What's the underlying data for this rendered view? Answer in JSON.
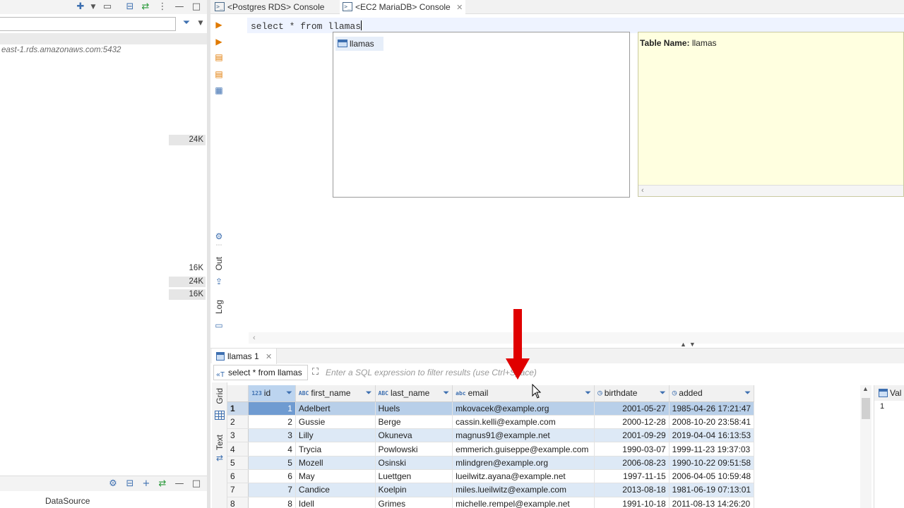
{
  "left_panel": {
    "connection_url": "east-1.rds.amazonaws.com:5432",
    "sizes": [
      "24K",
      "16K",
      "24K",
      "16K"
    ],
    "bottom_label": "DataSource"
  },
  "tabs": [
    {
      "label": "<Postgres RDS> Console",
      "active": false
    },
    {
      "label": "<EC2 MariaDB> Console",
      "active": true,
      "close": "✕"
    }
  ],
  "editor": {
    "sql": "select * from llamas",
    "side_labels": {
      "out": "Out",
      "log": "Log"
    }
  },
  "autocomplete": {
    "item": "llamas",
    "info_label": "Table Name:",
    "info_value": "llamas"
  },
  "results": {
    "tab_label": "llamas 1",
    "tab_close": "✕",
    "query_label": "select * from llamas",
    "filter_placeholder": "Enter a SQL expression to filter results (use Ctrl+Space)",
    "side_tabs": {
      "grid": "Grid",
      "text": "Text"
    },
    "columns": [
      {
        "name": "id",
        "type": "123"
      },
      {
        "name": "first_name",
        "type": "ABC"
      },
      {
        "name": "last_name",
        "type": "ABC"
      },
      {
        "name": "email",
        "type": "abc"
      },
      {
        "name": "birthdate",
        "type": "date"
      },
      {
        "name": "added",
        "type": "date"
      }
    ],
    "rows": [
      [
        "1",
        "1",
        "Adelbert",
        "Huels",
        "mkovacek@example.org",
        "2001-05-27",
        "1985-04-26 17:21:47"
      ],
      [
        "2",
        "2",
        "Gussie",
        "Berge",
        "cassin.kelli@example.com",
        "2000-12-28",
        "2008-10-20 23:58:41"
      ],
      [
        "3",
        "3",
        "Lilly",
        "Okuneva",
        "magnus91@example.net",
        "2001-09-29",
        "2019-04-04 16:13:53"
      ],
      [
        "4",
        "4",
        "Trycia",
        "Powlowski",
        "emmerich.guiseppe@example.com",
        "1990-03-07",
        "1999-11-23 19:37:03"
      ],
      [
        "5",
        "5",
        "Mozell",
        "Osinski",
        "mlindgren@example.org",
        "2006-08-23",
        "1990-10-22 09:51:58"
      ],
      [
        "6",
        "6",
        "May",
        "Luettgen",
        "lueilwitz.ayana@example.net",
        "1997-11-15",
        "2006-04-05 10:59:48"
      ],
      [
        "7",
        "7",
        "Candice",
        "Koelpin",
        "miles.lueilwitz@example.com",
        "2013-08-18",
        "1981-06-19 07:13:01"
      ],
      [
        "8",
        "8",
        "Idell",
        "Grimes",
        "michelle.rempel@example.net",
        "1991-10-18",
        "2011-08-13 14:26:20"
      ]
    ],
    "value_panel": {
      "header": "Val",
      "value": "1"
    }
  },
  "colors": {
    "accent": "#3d6fb0",
    "row_alt": "#dde9f6",
    "info_bg": "#ffffe0",
    "arrow": "#e00000"
  }
}
